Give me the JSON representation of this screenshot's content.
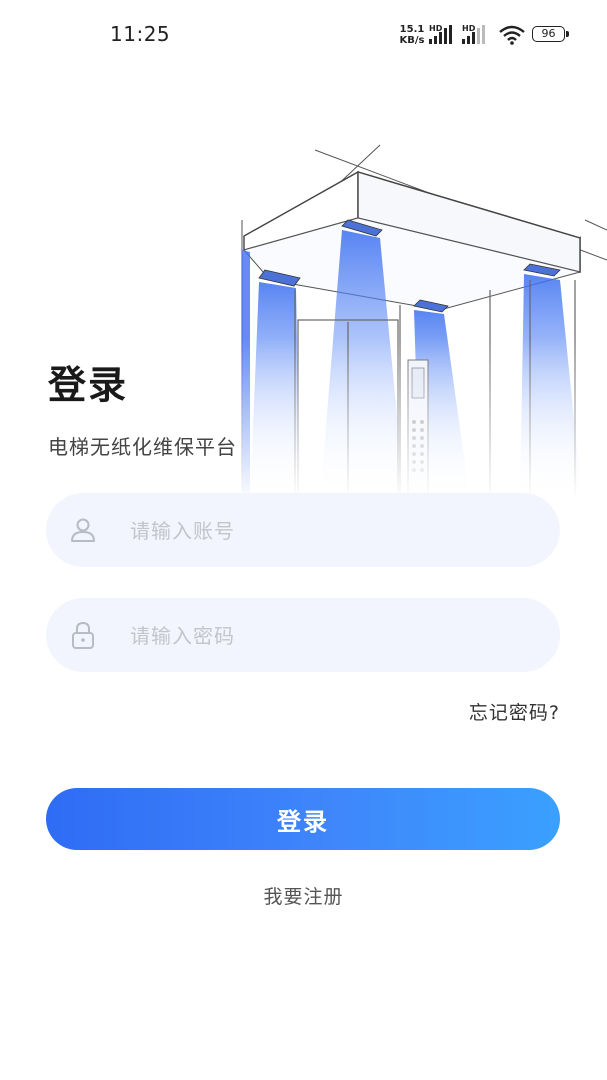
{
  "status_bar": {
    "time": "11:25",
    "net_speed_value": "15.1",
    "net_speed_unit": "KB/s",
    "hd_label": "HD",
    "battery": "96"
  },
  "page": {
    "title": "登录",
    "subtitle": "电梯无纸化维保平台"
  },
  "form": {
    "account_placeholder": "请输入账号",
    "password_placeholder": "请输入密码",
    "forgot_label": "忘记密码?",
    "login_label": "登录",
    "register_label": "我要注册"
  },
  "colors": {
    "accent_start": "#2f6cf5",
    "accent_end": "#3aa0ff",
    "input_bg": "#f2f5fd"
  },
  "icons": {
    "account": "user-icon",
    "password": "lock-icon",
    "hero": "elevator-illustration"
  }
}
